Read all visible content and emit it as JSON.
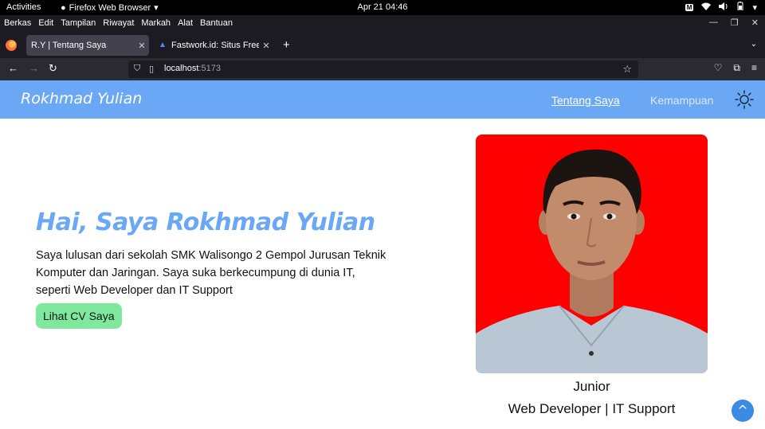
{
  "os": {
    "activities": "Activities",
    "app_name": "Firefox Web Browser",
    "clock": "Apr 21  04:46",
    "tray_badge": "M"
  },
  "menubar": {
    "items": [
      "Berkas",
      "Edit",
      "Tampilan",
      "Riwayat",
      "Markah",
      "Alat",
      "Bantuan"
    ]
  },
  "tabs": [
    {
      "title": "R.Y | Tentang Saya",
      "active": true
    },
    {
      "title": "Fastwork.id: Situs Freelance",
      "active": false
    }
  ],
  "navbar": {
    "url_host": "localhost",
    "url_port": ":5173"
  },
  "site": {
    "brand": "Rokhmad Yulian",
    "nav": [
      {
        "label": "Tentang Saya",
        "active": true
      },
      {
        "label": "Kemampuan",
        "active": false
      }
    ],
    "accent_color": "#6aa8f5",
    "theme_toggle_icon": "sun-icon"
  },
  "hero": {
    "title": "Hai, Saya Rokhmad Yulian",
    "description": "Saya lulusan dari sekolah SMK Walisongo 2 Gempol Jurusan Teknik Komputer dan Jaringan. Saya suka berkecumpung di dunia IT, seperti Web Developer dan IT Support",
    "cv_button": "Lihat CV Saya",
    "cv_button_color": "#7ee89d"
  },
  "profile": {
    "photo_bg": "#ff0000",
    "role_line1": "Junior",
    "role_line2": "Web Developer | IT Support"
  },
  "scroll_top": "^"
}
